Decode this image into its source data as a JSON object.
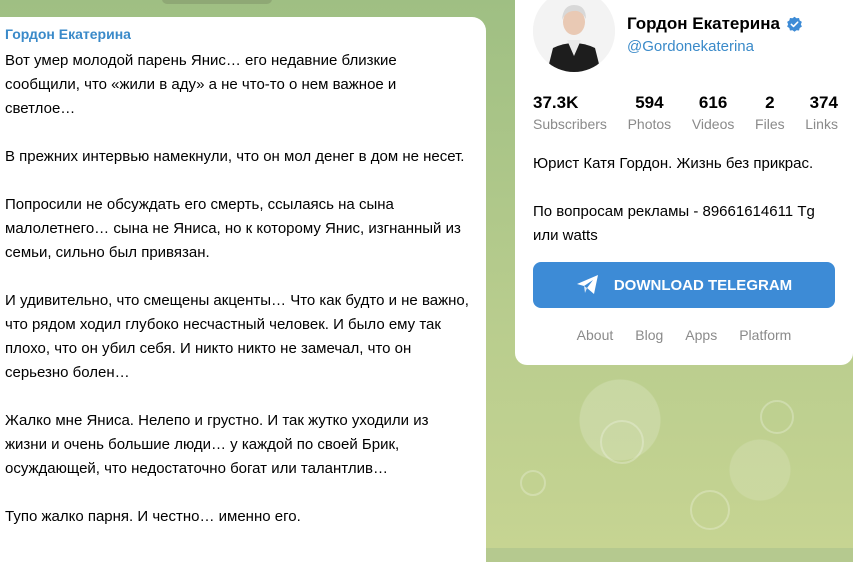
{
  "message": {
    "author": "Гордон Екатерина",
    "paragraphs": [
      "Вот умер молодой парень Янис… его недавние близкие сообщили, что «жили в аду» а не что-то о нем важное и светлое…",
      "В прежних интервью намекнули, что он мол денег в дом не несет.",
      "Попросили не обсуждать его смерть, ссылаясь на сына малолетнего… сына не Яниса, но к которому Янис, изгнанный из семьи, сильно был привязан.",
      "И удивительно, что смещены акценты… Что как будто и не важно, что рядом ходил глубоко несчастный человек. И было ему так плохо, что он убил себя. И никто никто не замечал, что он серьезно болен…",
      "Жалко мне Яниса. Нелепо и грустно. И так жутко уходили из жизни и очень большие люди… у каждой по своей Брик, осуждающей, что недостаточно богат или талантлив…",
      "Тупо жалко парня. И честно… именно его."
    ]
  },
  "channel": {
    "name": "Гордон Екатерина",
    "handle": "@Gordonekaterina",
    "stats": [
      {
        "value": "37.3K",
        "label": "Subscribers"
      },
      {
        "value": "594",
        "label": "Photos"
      },
      {
        "value": "616",
        "label": "Videos"
      },
      {
        "value": "2",
        "label": "Files"
      },
      {
        "value": "374",
        "label": "Links"
      }
    ],
    "description_1": "Юрист Катя Гордон. Жизнь без прикрас.",
    "description_2": "По вопросам рекламы - 89661614611 Tg или watts",
    "download_label": "DOWNLOAD TELEGRAM",
    "accent_color": "#3d8bd6"
  },
  "footer": {
    "links": [
      "About",
      "Blog",
      "Apps",
      "Platform"
    ]
  }
}
